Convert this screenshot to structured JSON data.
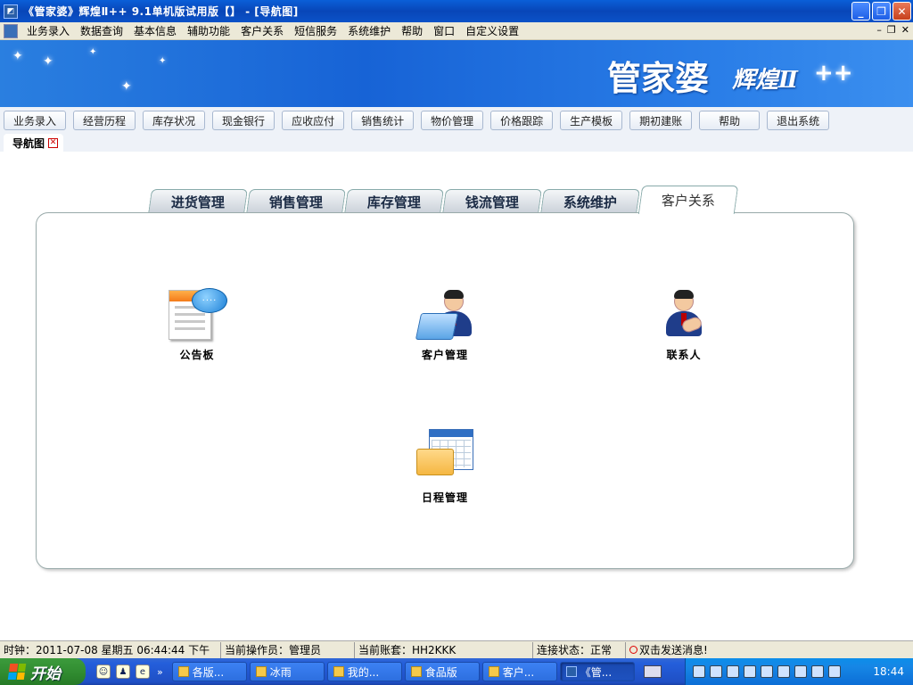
{
  "window": {
    "title": "《管家婆》辉煌Ⅱ++ 9.1单机版试用版【】 - [导航图]",
    "controls": [
      "_",
      "❐",
      "✕"
    ]
  },
  "menu": {
    "items": [
      "业务录入",
      "数据查询",
      "基本信息",
      "辅助功能",
      "客户关系",
      "短信服务",
      "系统维护",
      "帮助",
      "窗口",
      "自定义设置"
    ],
    "mdi_controls": [
      "–",
      "❐",
      "✕"
    ]
  },
  "banner": {
    "brand": "管家婆",
    "brand_sub": "辉煌Ⅱ",
    "brand_mark": "++"
  },
  "toolbar": {
    "buttons": [
      "业务录入",
      "经营历程",
      "库存状况",
      "现金银行",
      "应收应付",
      "销售统计",
      "物价管理",
      "价格跟踪",
      "生产模板",
      "期初建账",
      "帮助",
      "退出系统"
    ]
  },
  "doc_tab": {
    "label": "导航图"
  },
  "nav_tabs": {
    "items": [
      "进货管理",
      "销售管理",
      "库存管理",
      "钱流管理",
      "系统维护",
      "客户关系"
    ],
    "active": "客户关系"
  },
  "panel": {
    "tiles": [
      {
        "label": "公告板",
        "icon": "bulletin-board-icon"
      },
      {
        "label": "客户管理",
        "icon": "customer-management-icon"
      },
      {
        "label": "联系人",
        "icon": "contact-person-icon"
      },
      {
        "label": "日程管理",
        "icon": "schedule-calendar-icon"
      }
    ],
    "bubble_text": "····"
  },
  "statusbar": {
    "clock": "时钟：2011-07-08 星期五 06:44:44 下午",
    "operator": "当前操作员：管理员",
    "account": "当前账套：HH2KKK",
    "connection": "连接状态：正常",
    "message": "双击发送消息!"
  },
  "taskbar": {
    "start": "开始",
    "quicklaunch_more": "»",
    "tasks": [
      "各版...",
      "冰雨",
      "我的...",
      "食品版",
      "客户...",
      "《管..."
    ],
    "active_task": "《管...",
    "clock": "18:44"
  },
  "colors": {
    "titlebar": "#0846b8",
    "menu_bg": "#ece9d8",
    "banner": "#1763d6",
    "start_green": "#2f8a2f",
    "taskbar_blue": "#245edb"
  }
}
